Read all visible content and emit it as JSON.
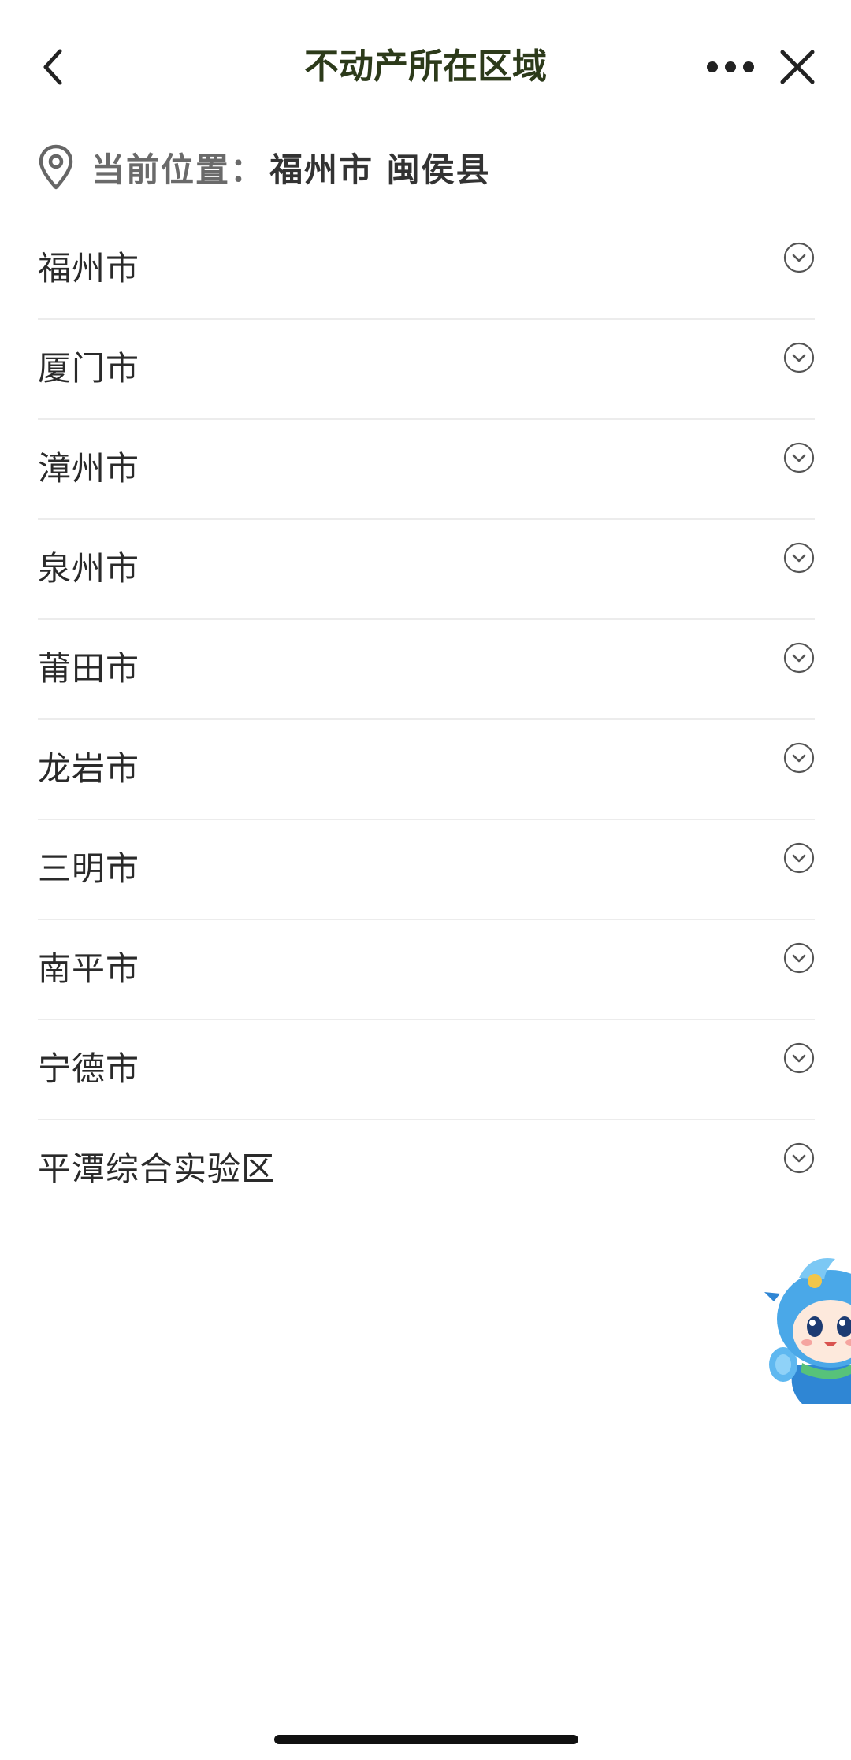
{
  "nav": {
    "title": "不动产所在区域"
  },
  "location": {
    "label": "当前位置：",
    "value": "福州市 闽侯县"
  },
  "regions": [
    {
      "label": "福州市"
    },
    {
      "label": "厦门市"
    },
    {
      "label": "漳州市"
    },
    {
      "label": "泉州市"
    },
    {
      "label": "莆田市"
    },
    {
      "label": "龙岩市"
    },
    {
      "label": "三明市"
    },
    {
      "label": "南平市"
    },
    {
      "label": "宁德市"
    },
    {
      "label": "平潭综合实验区"
    }
  ],
  "icons": {
    "back": "chevron-left-icon",
    "more": "more-dots-icon",
    "close": "close-icon",
    "location": "location-pin-icon",
    "expand": "chevron-down-circle-icon"
  },
  "colors": {
    "title": "#2c3a1a",
    "mascot_primary": "#4aa8e8"
  }
}
